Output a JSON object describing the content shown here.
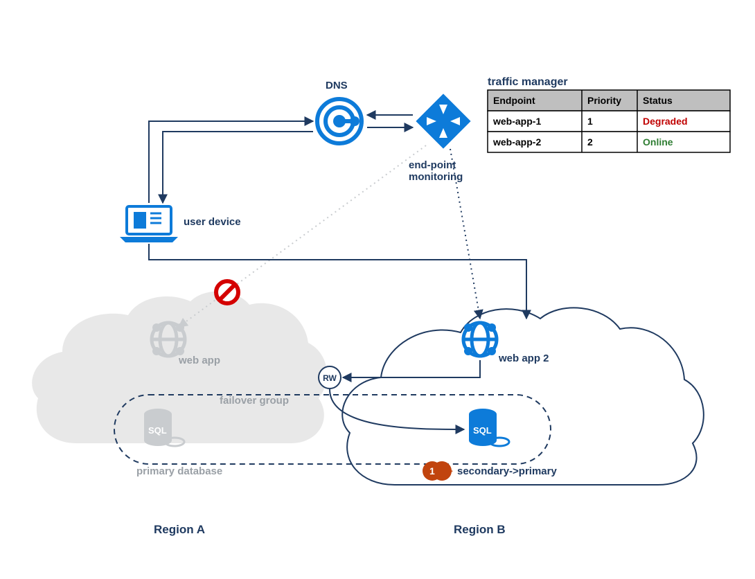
{
  "labels": {
    "dns": "DNS",
    "traffic_manager_title": "traffic manager",
    "endpoint_monitoring_l1": "end-point",
    "endpoint_monitoring_l2": "monitoring",
    "user_device": "user device",
    "web_app_a": "web app",
    "web_app_b": "web app 2",
    "failover_group": "failover group",
    "primary_db": "primary database",
    "secondary_db": "secondary->primary",
    "rw": "RW",
    "region_a": "Region A",
    "region_b": "Region B",
    "callout_num": "1"
  },
  "traffic_manager_table": {
    "headers": {
      "endpoint": "Endpoint",
      "priority": "Priority",
      "status": "Status"
    },
    "rows": [
      {
        "endpoint": "web-app-1",
        "priority": "1",
        "status": "Degraded",
        "status_class": "degraded"
      },
      {
        "endpoint": "web-app-2",
        "priority": "2",
        "status": "Online",
        "status_class": "online"
      }
    ]
  },
  "colors": {
    "navy": "#1f3a60",
    "blue": "#0d7bd9",
    "faded": "#c9cccf",
    "faded_text": "#9aa0a6",
    "badge": "#c1440e"
  }
}
